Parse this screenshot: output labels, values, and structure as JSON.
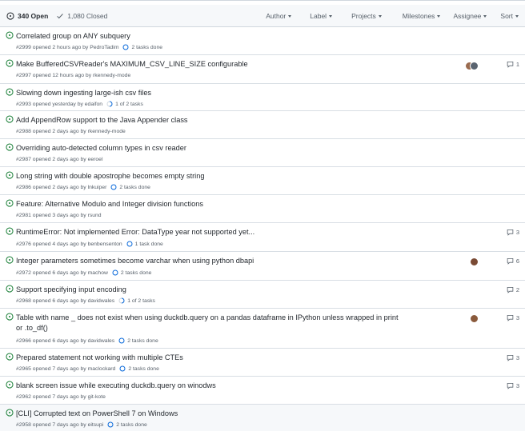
{
  "header": {
    "open_label": "340 Open",
    "closed_label": "1,080 Closed",
    "filters": [
      "Author",
      "Label",
      "Projects",
      "Milestones",
      "Assignee",
      "Sort"
    ]
  },
  "issues": [
    {
      "title": "Correlated group on ANY subquery",
      "meta": "#2999 opened 2 hours ago by PedroTadim",
      "tasks": "2 tasks done",
      "task_state": "empty",
      "comments": ""
    },
    {
      "title": "Make BufferedCSVReader's MAXIMUM_CSV_LINE_SIZE configurable",
      "meta": "#2997 opened 12 hours ago by rkennedy-mode",
      "tasks": "",
      "comments": "1"
    },
    {
      "title": "Slowing down ingesting large-ish csv files",
      "meta": "#2993 opened yesterday by edaifon",
      "tasks": "1 of 2 tasks",
      "task_state": "half",
      "comments": ""
    },
    {
      "title": "Add AppendRow support to the Java Appender class",
      "meta": "#2988 opened 2 days ago by rkennedy-mode",
      "tasks": "",
      "comments": ""
    },
    {
      "title": "Overriding auto-detected column types in csv reader",
      "meta": "#2987 opened 2 days ago by eeroel",
      "tasks": "",
      "comments": ""
    },
    {
      "title": "Long string with double apostrophe becomes empty string",
      "meta": "#2986 opened 2 days ago by lnkuiper",
      "tasks": "2 tasks done",
      "task_state": "empty",
      "comments": ""
    },
    {
      "title": "Feature: Alternative Modulo and Integer division functions",
      "meta": "#2981 opened 3 days ago by rsund",
      "tasks": "",
      "comments": ""
    },
    {
      "title": "RuntimeError: Not implemented Error: DataType year not supported yet...",
      "meta": "#2976 opened 4 days ago by benbensenton",
      "tasks": "1 task done",
      "task_state": "empty",
      "comments": "3"
    },
    {
      "title": "Integer parameters sometimes become varchar when using python dbapi",
      "meta": "#2972 opened 6 days ago by machow",
      "tasks": "2 tasks done",
      "task_state": "empty",
      "comments": "6"
    },
    {
      "title": "Support specifying input encoding",
      "meta": "#2968 opened 6 days ago by davidwales",
      "tasks": "1 of 2 tasks",
      "task_state": "half",
      "comments": "2"
    },
    {
      "title": "Table with name _ does not exist when using duckdb.query on a pandas dataframe in IPython unless wrapped in print or .to_df()",
      "meta": "#2966 opened 6 days ago by davidwales",
      "tasks": "2 tasks done",
      "task_state": "empty",
      "comments": "3"
    },
    {
      "title": "Prepared statement not working with multiple CTEs",
      "meta": "#2965 opened 7 days ago by maclockard",
      "tasks": "2 tasks done",
      "task_state": "empty",
      "comments": "3"
    },
    {
      "title": "blank screen issue while executing duckdb.query on winodws",
      "meta": "#2962 opened 7 days ago by git-kote",
      "tasks": "",
      "comments": "3"
    },
    {
      "title": "[CLI] Corrupted text on PowerShell 7 on Windows",
      "meta": "#2958 opened 7 days ago by eitsupi",
      "tasks": "2 tasks done",
      "task_state": "empty",
      "comments": ""
    }
  ],
  "colors": {
    "open_green": "#1a7f37",
    "task_blue": "#0969da",
    "muted": "#57606a"
  }
}
